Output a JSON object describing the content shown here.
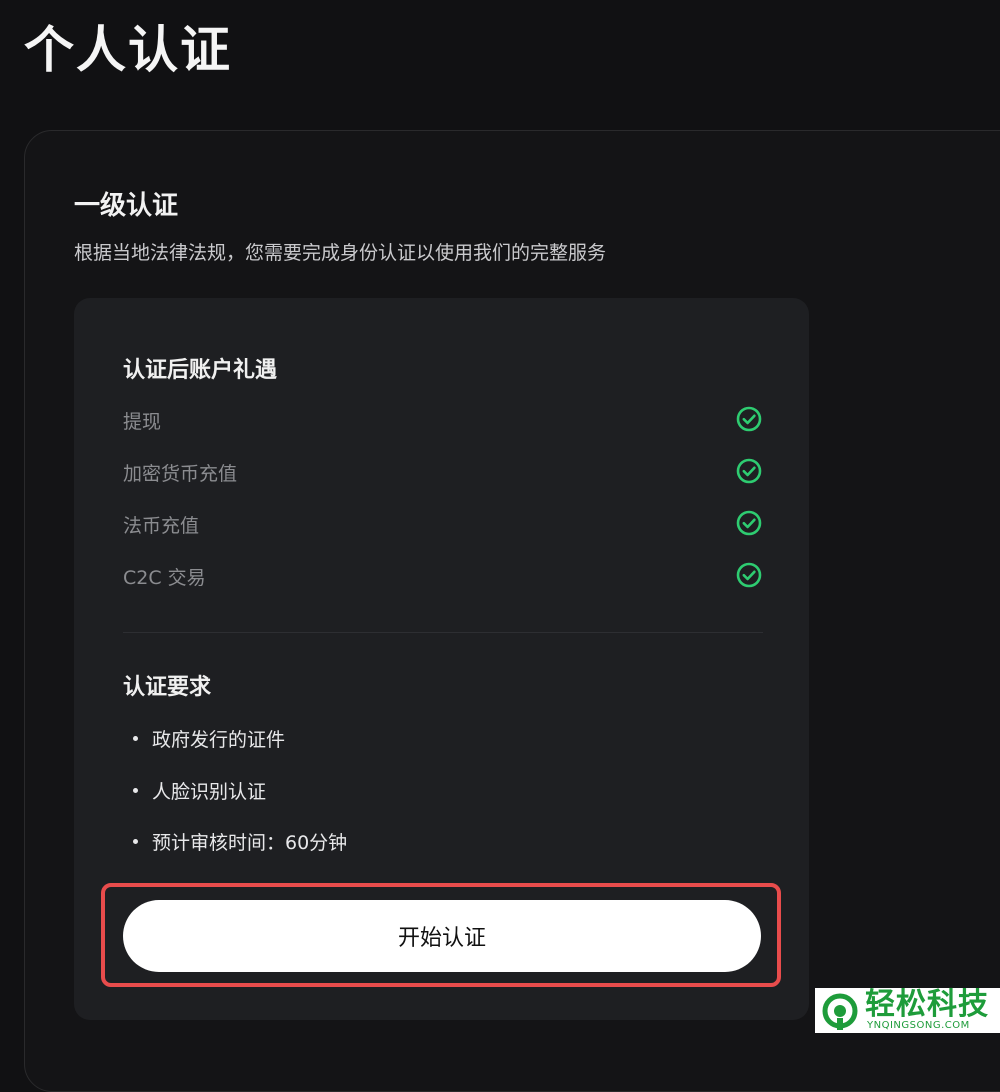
{
  "page": {
    "title": "个人认证"
  },
  "level": {
    "title": "一级认证",
    "description": "根据当地法律法规，您需要完成身份认证以使用我们的完整服务"
  },
  "benefits": {
    "title": "认证后账户礼遇",
    "items": [
      {
        "label": "提现",
        "icon": "check-circle-icon"
      },
      {
        "label": "加密货币充值",
        "icon": "check-circle-icon"
      },
      {
        "label": "法币充值",
        "icon": "check-circle-icon"
      },
      {
        "label": "C2C 交易",
        "icon": "check-circle-icon"
      }
    ]
  },
  "requirements": {
    "title": "认证要求",
    "items": [
      "政府发行的证件",
      "人脸识别认证",
      "预计审核时间：60分钟"
    ]
  },
  "action": {
    "start_label": "开始认证"
  },
  "watermark": {
    "name": "轻松科技",
    "site": "YNQINGSONG.COM"
  },
  "colors": {
    "background": "#111113",
    "card": "#1e1f22",
    "check": "#2ecc71",
    "highlight": "#e84c4c",
    "watermark": "#1e9c3a"
  }
}
